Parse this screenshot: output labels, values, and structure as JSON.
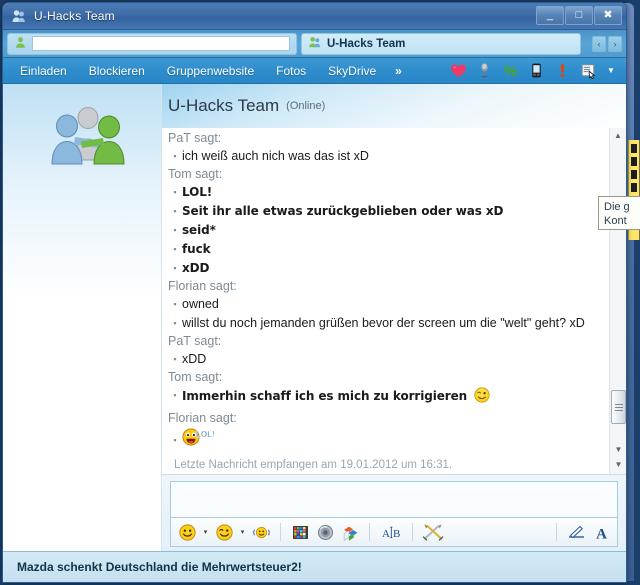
{
  "window": {
    "title": "U-Hacks Team",
    "icon": "contacts-group-icon",
    "minimize_label": "_",
    "maximize_label": "□",
    "close_label": "✖"
  },
  "tabs": {
    "blank_tab": {
      "icon": "contact-person-icon",
      "value": "",
      "placeholder": ""
    },
    "active_tab": {
      "icon": "contacts-group-icon",
      "label": "U-Hacks Team"
    },
    "nav_prev": "‹",
    "nav_next": "›"
  },
  "menu": {
    "items": [
      {
        "label": "Einladen"
      },
      {
        "label": "Blockieren"
      },
      {
        "label": "Gruppenwebsite"
      },
      {
        "label": "Fotos"
      },
      {
        "label": "SkyDrive"
      }
    ],
    "overflow": "»",
    "icons": [
      {
        "name": "heart-icon",
        "glyph": "♥",
        "color": "#e8336d"
      },
      {
        "name": "microphone-icon",
        "glyph": "Ἲ4",
        "color": "#6b7680"
      },
      {
        "name": "percent-icon",
        "glyph": "%",
        "color": "#4aa321"
      },
      {
        "name": "mobile-phone-icon",
        "glyph": "▮",
        "color": "#232323"
      },
      {
        "name": "exclamation-nudge-icon",
        "glyph": "!",
        "color": "#d24b13"
      },
      {
        "name": "invite-contact-icon",
        "glyph": "☰",
        "color": "#5b7082"
      },
      {
        "name": "dropdown-caret-icon",
        "glyph": "▾",
        "color": "#ffffff"
      }
    ]
  },
  "conversation": {
    "display_picture": "group-of-three-people-icon",
    "title": "U-Hacks Team",
    "status": "(Online)",
    "groups": [
      {
        "speaker": "PaT sagt:",
        "style": "normal",
        "messages": [
          "ich weiß auch nich was das ist xD"
        ]
      },
      {
        "speaker": "Tom sagt:",
        "style": "comic",
        "messages": [
          "LOL!",
          "Seit ihr alle etwas zurückgeblieben oder was xD",
          "seid*",
          "fuck",
          "xDD"
        ]
      },
      {
        "speaker": "Florian sagt:",
        "style": "normal",
        "messages": [
          "owned",
          "willst du noch jemanden grüßen bevor der screen um die \"welt\" geht? xD"
        ]
      },
      {
        "speaker": "PaT sagt:",
        "style": "normal",
        "messages": [
          "xDD"
        ]
      },
      {
        "speaker": "Tom sagt:",
        "style": "comic",
        "messages": [
          "Immerhin schaff ich es mich zu korrigieren"
        ],
        "trailing_emoticon": "winking-smiley-icon"
      },
      {
        "speaker": "Florian sagt:",
        "style": "normal",
        "messages": [
          ""
        ],
        "emoticon_only": "lol-smiley-icon",
        "emoticon_text": "LOL!"
      }
    ],
    "last_message": "Letzte Nachricht empfangen am 19.01.2012 um 16:31.",
    "scrollbar": {
      "up_arrow": "▲",
      "down_arrow": "▼",
      "page_down_arrow": "▼"
    }
  },
  "message_input": {
    "value": "",
    "placeholder": ""
  },
  "format_toolbar": {
    "buttons": [
      {
        "name": "emoticon-button",
        "glyph": "☺",
        "caret": "▾"
      },
      {
        "name": "winking-emoticon-button",
        "glyph": "☻",
        "caret": "▾"
      },
      {
        "name": "nudge-button",
        "glyph": "☺",
        "caret": ""
      },
      {
        "name": "color-palette-button",
        "glyph": "▦",
        "caret": ""
      },
      {
        "name": "sound-button",
        "glyph": "◉",
        "caret": ""
      },
      {
        "name": "backgrounds-button",
        "glyph": "◧",
        "caret": ""
      },
      {
        "name": "translate-ab-button",
        "glyph": "A|B",
        "caret": ""
      },
      {
        "name": "games-swords-button",
        "glyph": "⚔",
        "caret": ""
      },
      {
        "name": "handwriting-pen-button",
        "glyph": "✎",
        "caret": ""
      },
      {
        "name": "font-select-button",
        "glyph": "A",
        "caret": ""
      }
    ]
  },
  "tooltip": {
    "line1": "Die g",
    "line2": "Kont"
  },
  "status_bar": {
    "text": "Mazda schenkt Deutschland die Mehrwertsteuer2!"
  }
}
